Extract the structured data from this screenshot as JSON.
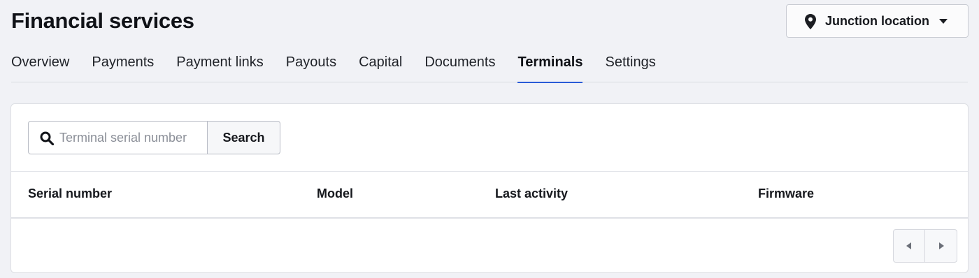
{
  "header": {
    "title": "Financial services",
    "location_button": {
      "label": "Junction location",
      "icon": "map-pin-icon",
      "dropdown_icon": "caret-down-icon"
    }
  },
  "tabs": [
    {
      "label": "Overview",
      "active": false
    },
    {
      "label": "Payments",
      "active": false
    },
    {
      "label": "Payment links",
      "active": false
    },
    {
      "label": "Payouts",
      "active": false
    },
    {
      "label": "Capital",
      "active": false
    },
    {
      "label": "Documents",
      "active": false
    },
    {
      "label": "Terminals",
      "active": true
    },
    {
      "label": "Settings",
      "active": false
    }
  ],
  "search": {
    "icon": "search-icon",
    "value": "",
    "placeholder": "Terminal serial number",
    "button_label": "Search"
  },
  "table": {
    "columns": [
      "Serial number",
      "Model",
      "Last activity",
      "Firmware"
    ],
    "rows": []
  },
  "pagination": {
    "prev_icon": "caret-left-icon",
    "next_icon": "caret-right-icon"
  },
  "colors": {
    "background": "#f1f2f6",
    "accent": "#2a5bd7",
    "card": "#ffffff",
    "text": "#16181d",
    "placeholder": "#8b8f98"
  }
}
